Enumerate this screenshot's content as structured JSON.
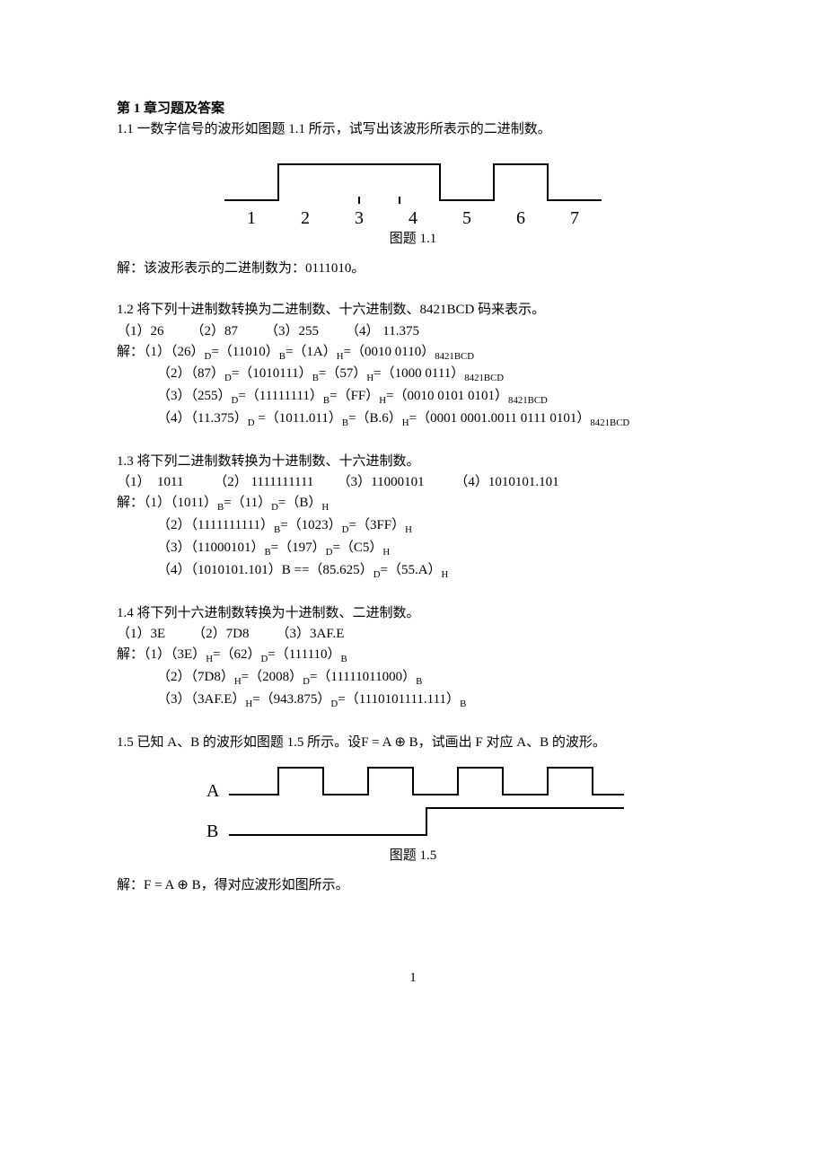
{
  "chapter_title": "第 1 章习题及答案",
  "q11": {
    "prompt": "1.1  一数字信号的波形如图题 1.1 所示，试写出该波形所表示的二进制数。",
    "caption": "图题 1.1",
    "answer": "解：该波形表示的二进制数为：0111010。",
    "labels": [
      "1",
      "2",
      "3",
      "4",
      "5",
      "6",
      "7"
    ]
  },
  "q12": {
    "prompt": "1.2 将下列十进制数转换为二进制数、十六进制数、8421BCD 码来表示。",
    "items": "（1）26        （2）87        （3）255        （4） 11.375",
    "ans_label": "解：",
    "a1_a": "（1）（26）",
    "a1_b": "=（11010）",
    "a1_c": "=（1A）",
    "a1_d": "=（0010 0110）",
    "a2_a": "（2）（87）",
    "a2_b": "=（1010111）",
    "a2_c": "=（57）",
    "a2_d": "=（1000 0111）",
    "a3_a": "（3）（255）",
    "a3_b": "=（11111111）",
    "a3_c": "=（FF）",
    "a3_d": "=（0010 0101 0101）",
    "a4_a": "（4）（11.375）",
    "a4_b": " =（1011.011）",
    "a4_c": "=（B.6）",
    "a4_d": "=（0001 0001.0011 0111 0101）",
    "sub_D": "D",
    "sub_B": "B",
    "sub_H": "H",
    "sub_BCD": "8421BCD"
  },
  "q13": {
    "prompt": "1.3 将下列二进制数转换为十进制数、十六进制数。",
    "items": "（1）  1011         （2） 1111111111       （3）11000101         （4）1010101.101",
    "ans_label": "解：",
    "a1_a": "（1）（1011）",
    "a1_b": "=（11）",
    "a1_c": "=（B）",
    "a2_a": "（2）（1111111111）",
    "a2_b": "=（1023）",
    "a2_c": "=（3FF）",
    "a3_a": "（3）（11000101）",
    "a3_b": "=（197）",
    "a3_c": "=（C5）",
    "a4_a": "（4）（1010101.101）B ==（85.625）",
    "a4_b": "=（55.A）",
    "sub_D": "D",
    "sub_B": "B",
    "sub_H": "H"
  },
  "q14": {
    "prompt": "1.4 将下列十六进制数转换为十进制数、二进制数。",
    "items": "（1）3E        （2）7D8        （3）3AF.E",
    "ans_label": "解：",
    "a1_a": "（1）（3E）",
    "a1_b": "=（62）",
    "a1_c": "=（111110）",
    "a2_a": "（2）（7D8）",
    "a2_b": "=（2008）",
    "a2_c": "=（11111011000）",
    "a3_a": "（3）（3AF.E）",
    "a3_b": "=（943.875）",
    "a3_c": "=（1110101111.111）",
    "sub_D": "D",
    "sub_B": "B",
    "sub_H": "H"
  },
  "q15": {
    "prompt_a": "1.5 已知 A、B 的波形如图题 1.5 所示。设",
    "formula1": "F = A ⊕ B",
    "prompt_b": "，试画出 F 对应 A、B 的波形。",
    "label_A": "A",
    "label_B": "B",
    "caption": "图题 1.5",
    "answer_a": "解：",
    "formula2": "F = A ⊕ B",
    "answer_b": "，得对应波形如图所示。"
  },
  "page_number": "1"
}
